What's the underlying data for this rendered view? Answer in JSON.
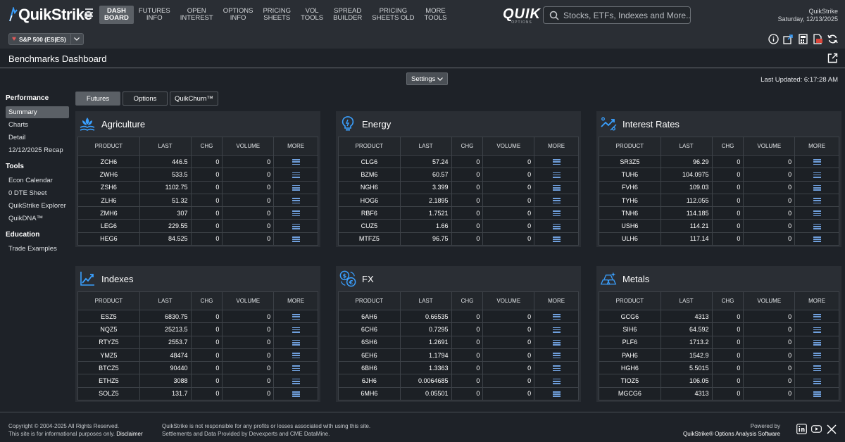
{
  "header": {
    "logo_text": "QuikStrike",
    "nav": [
      {
        "label": "DASH\nBOARD",
        "active": true
      },
      {
        "label": "FUTURES\nINFO"
      },
      {
        "label": "OPEN\nINTEREST"
      },
      {
        "label": "OPTIONS\nINFO"
      },
      {
        "label": "PRICING\nSHEETS"
      },
      {
        "label": "VOL\nTOOLS"
      },
      {
        "label": "SPREAD\nBUILDER"
      },
      {
        "label": "PRICING\nSHEETS OLD"
      },
      {
        "label": "MORE\nTOOLS"
      }
    ],
    "brand": "QUIK",
    "brand_sub": "OPTIONS",
    "search_placeholder": "Stocks, ETFs, Indexes and More...",
    "user_name": "QuikStrike",
    "date": "Saturday, 12/13/2025",
    "symbol_label": "S&P 500 (ES|ES)"
  },
  "page": {
    "title": "Benchmarks Dashboard",
    "settings_label": "Settings",
    "last_updated": "Last Updated: 6:17:28 AM"
  },
  "sidebar": {
    "groups": [
      {
        "title": "Performance",
        "items": [
          "Summary",
          "Charts",
          "Detail",
          "12/12/2025 Recap"
        ]
      },
      {
        "title": "Tools",
        "items": [
          "Econ Calendar",
          "0 DTE Sheet",
          "QuikStrike Explorer",
          "QuikDNA™"
        ]
      },
      {
        "title": "Education",
        "items": [
          "Trade Examples"
        ]
      }
    ]
  },
  "tabs": [
    "Futures",
    "Options",
    "QuikChurn™"
  ],
  "columns": [
    "PRODUCT",
    "LAST",
    "CHG",
    "VOLUME",
    "MORE"
  ],
  "panels": [
    {
      "title": "Agriculture",
      "icon": "agriculture-icon",
      "rows": [
        [
          "ZCH6",
          "446.5",
          "0",
          "0"
        ],
        [
          "ZWH6",
          "533.5",
          "0",
          "0"
        ],
        [
          "ZSH6",
          "1102.75",
          "0",
          "0"
        ],
        [
          "ZLH6",
          "51.32",
          "0",
          "0"
        ],
        [
          "ZMH6",
          "307",
          "0",
          "0"
        ],
        [
          "LEG6",
          "229.55",
          "0",
          "0"
        ],
        [
          "HEG6",
          "84.525",
          "0",
          "0"
        ]
      ]
    },
    {
      "title": "Energy",
      "icon": "energy-icon",
      "rows": [
        [
          "CLG6",
          "57.24",
          "0",
          "0"
        ],
        [
          "BZM6",
          "60.57",
          "0",
          "0"
        ],
        [
          "NGH6",
          "3.399",
          "0",
          "0"
        ],
        [
          "HOG6",
          "2.1895",
          "0",
          "0"
        ],
        [
          "RBF6",
          "1.7521",
          "0",
          "0"
        ],
        [
          "CUZ5",
          "1.66",
          "0",
          "0"
        ],
        [
          "MTFZ5",
          "96.75",
          "0",
          "0"
        ]
      ]
    },
    {
      "title": "Interest Rates",
      "icon": "interest-rates-icon",
      "rows": [
        [
          "SR3Z5",
          "96.29",
          "0",
          "0"
        ],
        [
          "TUH6",
          "104.0975",
          "0",
          "0"
        ],
        [
          "FVH6",
          "109.03",
          "0",
          "0"
        ],
        [
          "TYH6",
          "112.055",
          "0",
          "0"
        ],
        [
          "TNH6",
          "114.185",
          "0",
          "0"
        ],
        [
          "USH6",
          "114.21",
          "0",
          "0"
        ],
        [
          "ULH6",
          "117.14",
          "0",
          "0"
        ]
      ]
    },
    {
      "title": "Indexes",
      "icon": "indexes-icon",
      "rows": [
        [
          "ESZ5",
          "6830.75",
          "0",
          "0"
        ],
        [
          "NQZ5",
          "25213.5",
          "0",
          "0"
        ],
        [
          "RTYZ5",
          "2553.7",
          "0",
          "0"
        ],
        [
          "YMZ5",
          "48474",
          "0",
          "0"
        ],
        [
          "BTCZ5",
          "90440",
          "0",
          "0"
        ],
        [
          "ETHZ5",
          "3088",
          "0",
          "0"
        ],
        [
          "SOLZ5",
          "131.7",
          "0",
          "0"
        ]
      ]
    },
    {
      "title": "FX",
      "icon": "fx-icon",
      "rows": [
        [
          "6AH6",
          "0.66535",
          "0",
          "0"
        ],
        [
          "6CH6",
          "0.7295",
          "0",
          "0"
        ],
        [
          "6SH6",
          "1.2691",
          "0",
          "0"
        ],
        [
          "6EH6",
          "1.1794",
          "0",
          "0"
        ],
        [
          "6BH6",
          "1.3363",
          "0",
          "0"
        ],
        [
          "6JH6",
          "0.0064685",
          "0",
          "0"
        ],
        [
          "6MH6",
          "0.05501",
          "0",
          "0"
        ]
      ]
    },
    {
      "title": "Metals",
      "icon": "metals-icon",
      "rows": [
        [
          "GCG6",
          "4313",
          "0",
          "0"
        ],
        [
          "SIH6",
          "64.592",
          "0",
          "0"
        ],
        [
          "PLF6",
          "1713.2",
          "0",
          "0"
        ],
        [
          "PAH6",
          "1542.9",
          "0",
          "0"
        ],
        [
          "HGH6",
          "5.5015",
          "0",
          "0"
        ],
        [
          "TIOZ5",
          "106.05",
          "0",
          "0"
        ],
        [
          "MGCG6",
          "4313",
          "0",
          "0"
        ]
      ]
    }
  ],
  "footer": {
    "copyright": "Copyright © 2004-2025 All Rights Reserved.",
    "info_line": "This site is for informational purposes only.",
    "disclaimer": "Disclaimer",
    "notice1": "QuikStrike is not responsible for any profits or losses associated with using this site.",
    "notice2": "Settlements and Data Provided by Devexperts and CME DataMine.",
    "powered": "Powered by",
    "software": "QuikStrike® Options Analysis Software"
  },
  "colors": {
    "accent": "#3aa0ff",
    "more_icon": "#6f9fdc",
    "panel_bg": "#2a2e34"
  }
}
